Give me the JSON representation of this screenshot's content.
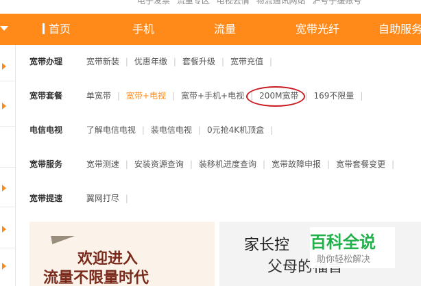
{
  "top_links": [
    "电子发票",
    "流量专区",
    "电视云情",
    "物流通讯网站",
    "沪号子缓账号"
  ],
  "nav": {
    "items": [
      "首页",
      "手机",
      "流量",
      "宽带光纤",
      "自助服务"
    ]
  },
  "rows": [
    {
      "title": "宽带办理",
      "links": [
        "宽带新装",
        "优惠年缴",
        "套餐升级",
        "宽带充值"
      ]
    },
    {
      "title": "宽带套餐",
      "links": [
        "单宽带",
        "宽带+电视",
        "宽带+手机+电视",
        "200M宽带",
        "169不限量"
      ],
      "active": "宽带+电视"
    },
    {
      "title": "电信电视",
      "links": [
        "了解电信电视",
        "装电信电视",
        "0元抢4K机顶盒"
      ]
    },
    {
      "title": "宽带服务",
      "links": [
        "宽带测速",
        "安装资源查询",
        "装移机进度查询",
        "宽带故障申报",
        "宽带套餐变更"
      ]
    },
    {
      "title": "宽带提速",
      "links": [
        "翼网打尽"
      ]
    }
  ],
  "banner_left": {
    "line1": "欢迎进入",
    "line2": "流量不限量时代"
  },
  "banner_right": {
    "line1": "家长控",
    "line2": "父母的福音"
  },
  "watermark": {
    "logo": "百科全说",
    "sub": "助你轻松解决"
  },
  "colors": {
    "accent": "#ff8a1a",
    "highlight_circle": "#c9191e",
    "watermark_green": "#22b04a"
  }
}
